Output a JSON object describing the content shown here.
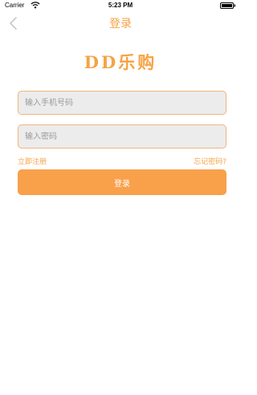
{
  "status_bar": {
    "carrier": "Carrier",
    "time": "5:23 PM"
  },
  "nav": {
    "title": "登录",
    "back_icon": "chevron-left-icon"
  },
  "logo": {
    "text": "DD乐购"
  },
  "form": {
    "phone_placeholder": "输入手机号码",
    "phone_value": "",
    "password_placeholder": "输入密码",
    "password_value": "",
    "register_label": "立即注册",
    "forgot_label": "忘记密码?",
    "login_label": "登录"
  },
  "colors": {
    "accent": "#f7a244",
    "button": "#f9a04b",
    "input_bg": "#ececec",
    "input_border": "#f0b57a"
  }
}
